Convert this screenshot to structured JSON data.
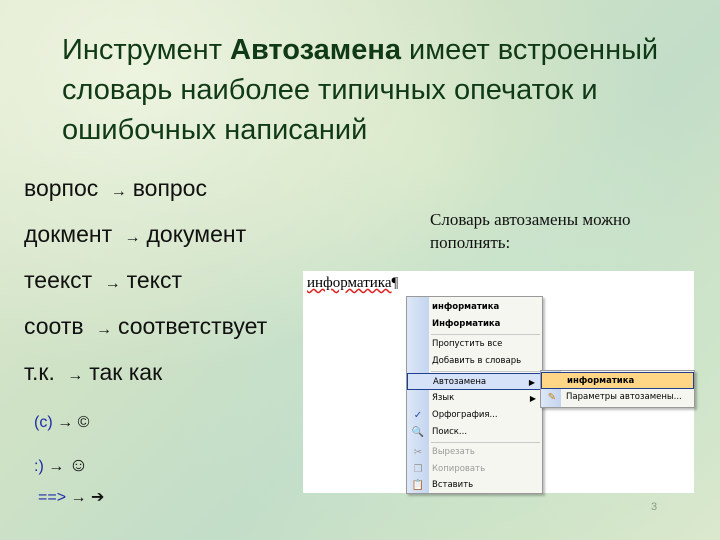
{
  "title": {
    "part1": "Инструмент ",
    "bold": "Автозамена",
    "part2": " имеет встроенный словарь наиболее типичных опечаток и ошибочных написаний"
  },
  "examples": [
    {
      "from": "ворпос",
      "arrow": "→",
      "to": "вопрос"
    },
    {
      "from": "докмент",
      "arrow": "→",
      "to": "документ"
    },
    {
      "from": "теекст",
      "arrow": "→",
      "to": "текст"
    },
    {
      "from": "соотв",
      "arrow": "→",
      "to": "соответствует"
    },
    {
      "from": "т.к.",
      "arrow": "→",
      "to": "так как"
    }
  ],
  "symbols": [
    {
      "from": "(c)",
      "arrow": "→",
      "to": "©"
    },
    {
      "from": ":)",
      "arrow": "→",
      "to": "☺"
    },
    {
      "from": "==>",
      "arrow": "→",
      "to": "➔"
    }
  ],
  "note": "Словарь автозамены можно пополнять:",
  "page_number": "3",
  "screenshot": {
    "doc_word": "информатика",
    "pilcrow": "¶",
    "menu": [
      {
        "label": "информатика",
        "bold": true
      },
      {
        "label": "Информатика",
        "bold": true
      },
      {
        "label": "Пропустить все"
      },
      {
        "label": "Добавить в словарь"
      },
      {
        "label": "Автозамена",
        "submenu": true
      },
      {
        "label": "Язык",
        "submenu": true
      },
      {
        "label": "Орфография...",
        "icon": "spelling-icon"
      },
      {
        "label": "Поиск...",
        "icon": "search-icon"
      },
      {
        "label": "Вырезать",
        "icon": "cut-icon",
        "disabled": true
      },
      {
        "label": "Копировать",
        "icon": "copy-icon",
        "disabled": true
      },
      {
        "label": "Вставить",
        "icon": "paste-icon"
      }
    ],
    "submenu": [
      {
        "label": "информатика",
        "bold": true
      },
      {
        "label": "Параметры автозамены...",
        "icon": "autocorrect-options-icon"
      }
    ]
  }
}
